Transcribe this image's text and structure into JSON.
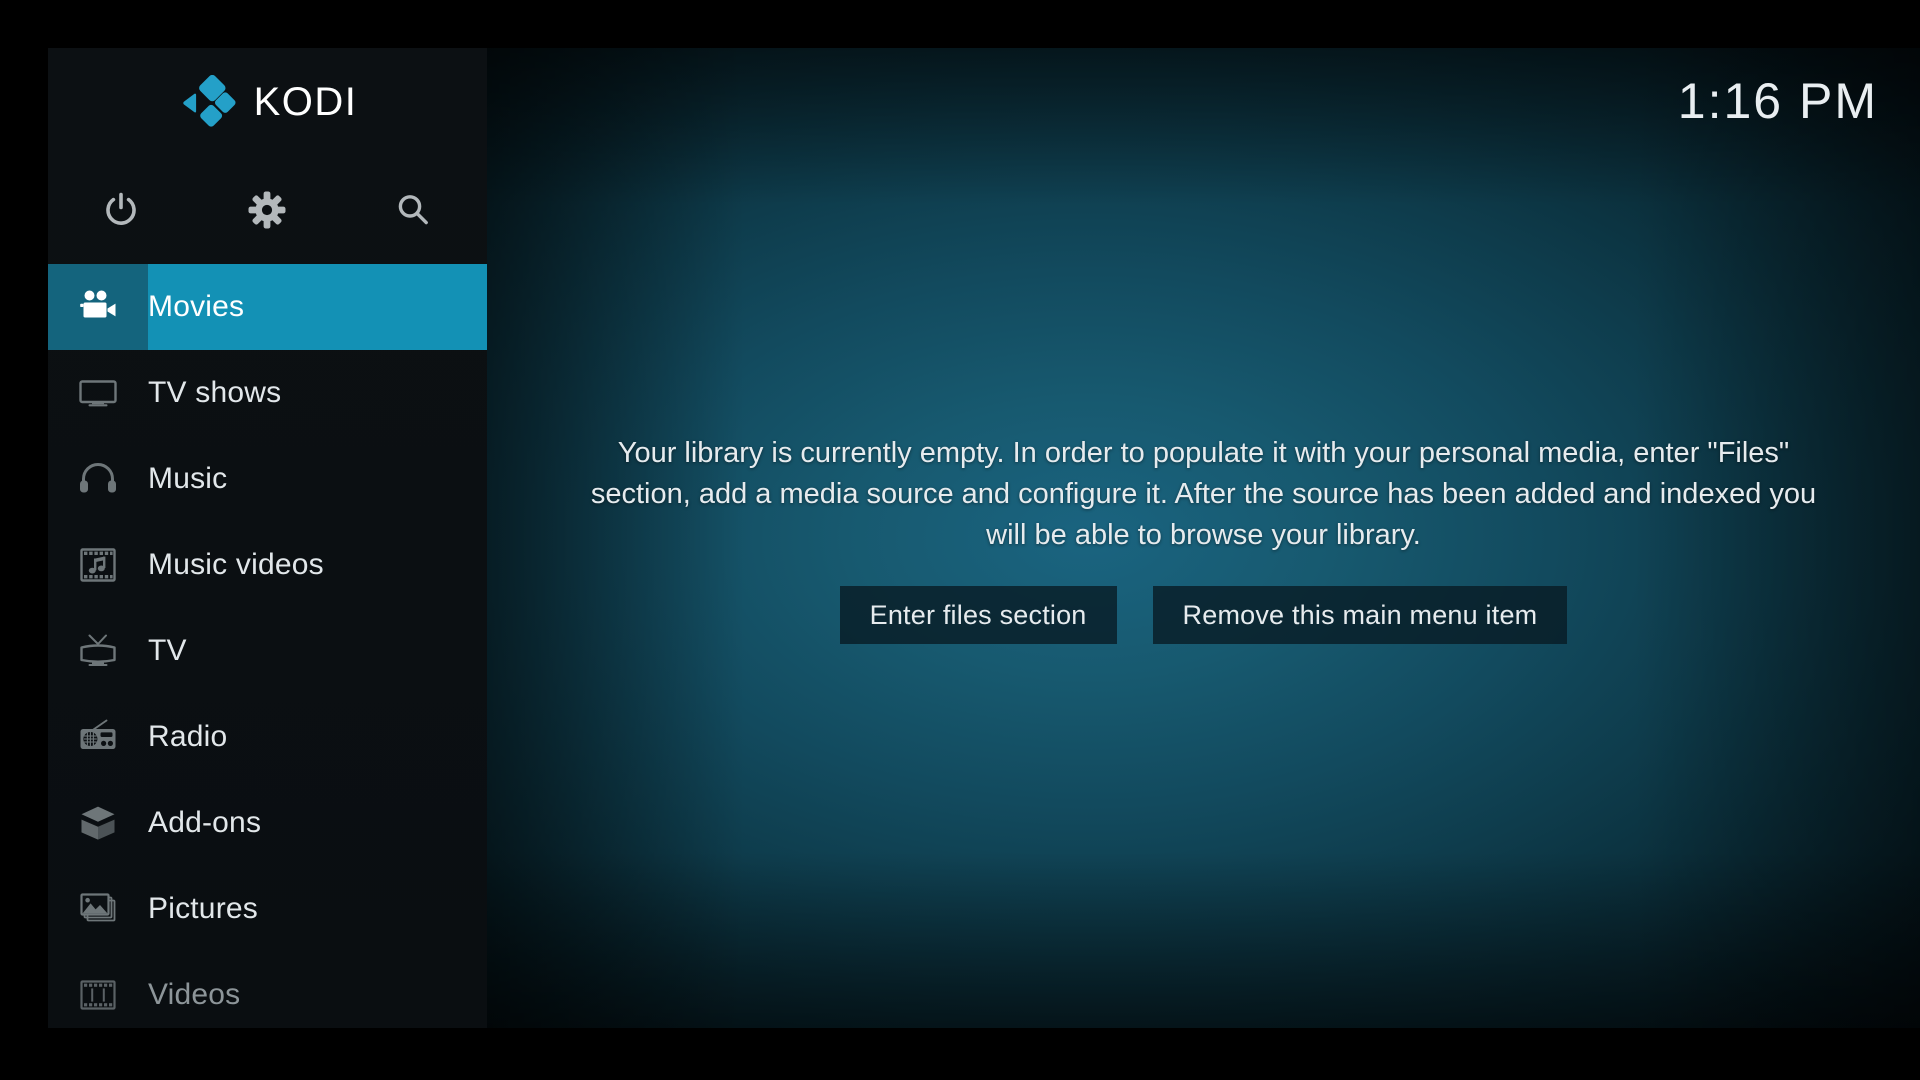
{
  "app": {
    "name": "Kodi",
    "brand_text": "KODI",
    "logo_icon": "kodi-logo-icon",
    "accent_color": "#1391b5",
    "accent_dark_color": "#14647d",
    "sidebar_bg_color": "#0c1013",
    "background_center_color": "#1a6480",
    "background_edge_color": "#01080d"
  },
  "clock": {
    "time": "1:16 PM"
  },
  "quickbar": {
    "items": [
      {
        "name": "power",
        "icon": "power-icon",
        "label": "Power"
      },
      {
        "name": "settings",
        "icon": "gear-icon",
        "label": "Settings"
      },
      {
        "name": "search",
        "icon": "search-icon",
        "label": "Search"
      }
    ]
  },
  "sidebar": {
    "items": [
      {
        "label": "Movies",
        "icon": "movie-camera-icon",
        "selected": true,
        "dimmed": false
      },
      {
        "label": "TV shows",
        "icon": "monitor-icon",
        "selected": false,
        "dimmed": false
      },
      {
        "label": "Music",
        "icon": "headphones-icon",
        "selected": false,
        "dimmed": false
      },
      {
        "label": "Music videos",
        "icon": "film-music-icon",
        "selected": false,
        "dimmed": false
      },
      {
        "label": "TV",
        "icon": "television-icon",
        "selected": false,
        "dimmed": false
      },
      {
        "label": "Radio",
        "icon": "radio-icon",
        "selected": false,
        "dimmed": false
      },
      {
        "label": "Add-ons",
        "icon": "open-box-icon",
        "selected": false,
        "dimmed": false
      },
      {
        "label": "Pictures",
        "icon": "photo-icon",
        "selected": false,
        "dimmed": false
      },
      {
        "label": "Videos",
        "icon": "film-strip-icon",
        "selected": false,
        "dimmed": true
      }
    ]
  },
  "main": {
    "empty_message": "Your library is currently empty. In order to populate it with your personal media, enter \"Files\" section, add a media source and configure it. After the source has been added and indexed you will be able to browse your library.",
    "buttons": [
      {
        "label": "Enter files section",
        "name": "enter-files-section"
      },
      {
        "label": "Remove this main menu item",
        "name": "remove-main-menu-item"
      }
    ]
  }
}
